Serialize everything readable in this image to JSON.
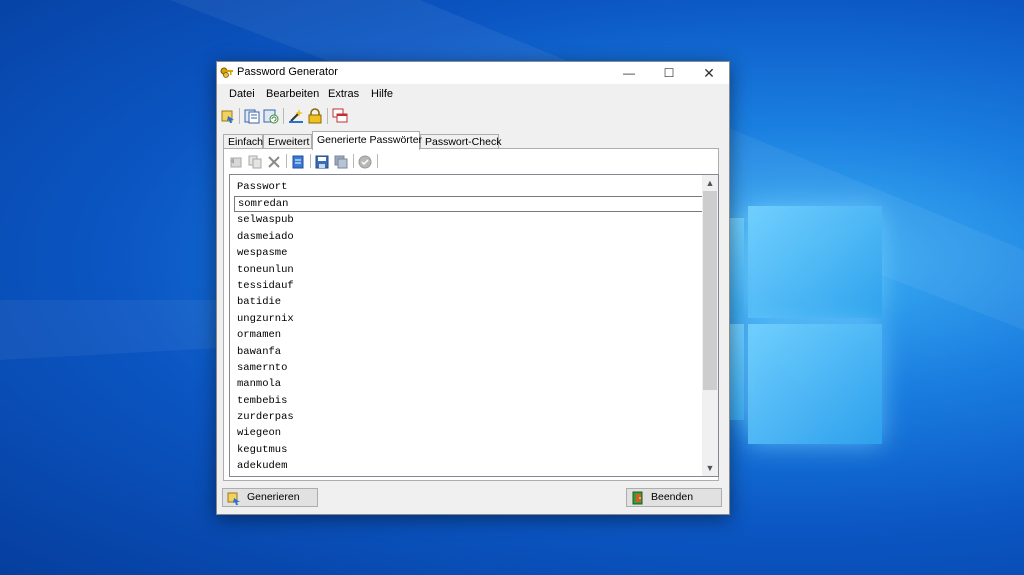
{
  "window": {
    "title": "Password Generator",
    "app_icon": "keys-icon",
    "controls": {
      "minimize": "—",
      "maximize": "☐",
      "close": "✕"
    }
  },
  "menu": [
    "Datei",
    "Bearbeiten",
    "Extras",
    "Hilfe"
  ],
  "toolbar_icons": [
    "generate-icon",
    "copy-list-icon",
    "refresh-icon",
    "settings-wand-icon",
    "lock-icon",
    "windows-icon"
  ],
  "tabs": [
    {
      "label": "Einfach",
      "active": false
    },
    {
      "label": "Erweitert",
      "active": false
    },
    {
      "label": "Generierte Passwörter",
      "active": true
    },
    {
      "label": "Passwort-Check",
      "active": false
    }
  ],
  "panel_toolbar_icons": [
    "undo-icon",
    "copy-icon",
    "delete-icon",
    "document-icon",
    "save-icon",
    "save-all-icon",
    "check-icon"
  ],
  "list": {
    "header": "Passwort",
    "selected_index": 0,
    "rows": [
      "somredan",
      "selwaspub",
      "dasmeiado",
      "wespasme",
      "toneunlun",
      "tessidauf",
      "batidie",
      "ungzurnix",
      "ormamen",
      "bawanfa",
      "samernto",
      "manmola",
      "tembebis",
      "zurderpas",
      "wiegeon",
      "kegutmus",
      "adekudem"
    ]
  },
  "buttons": {
    "generate": "Generieren",
    "quit": "Beenden"
  }
}
